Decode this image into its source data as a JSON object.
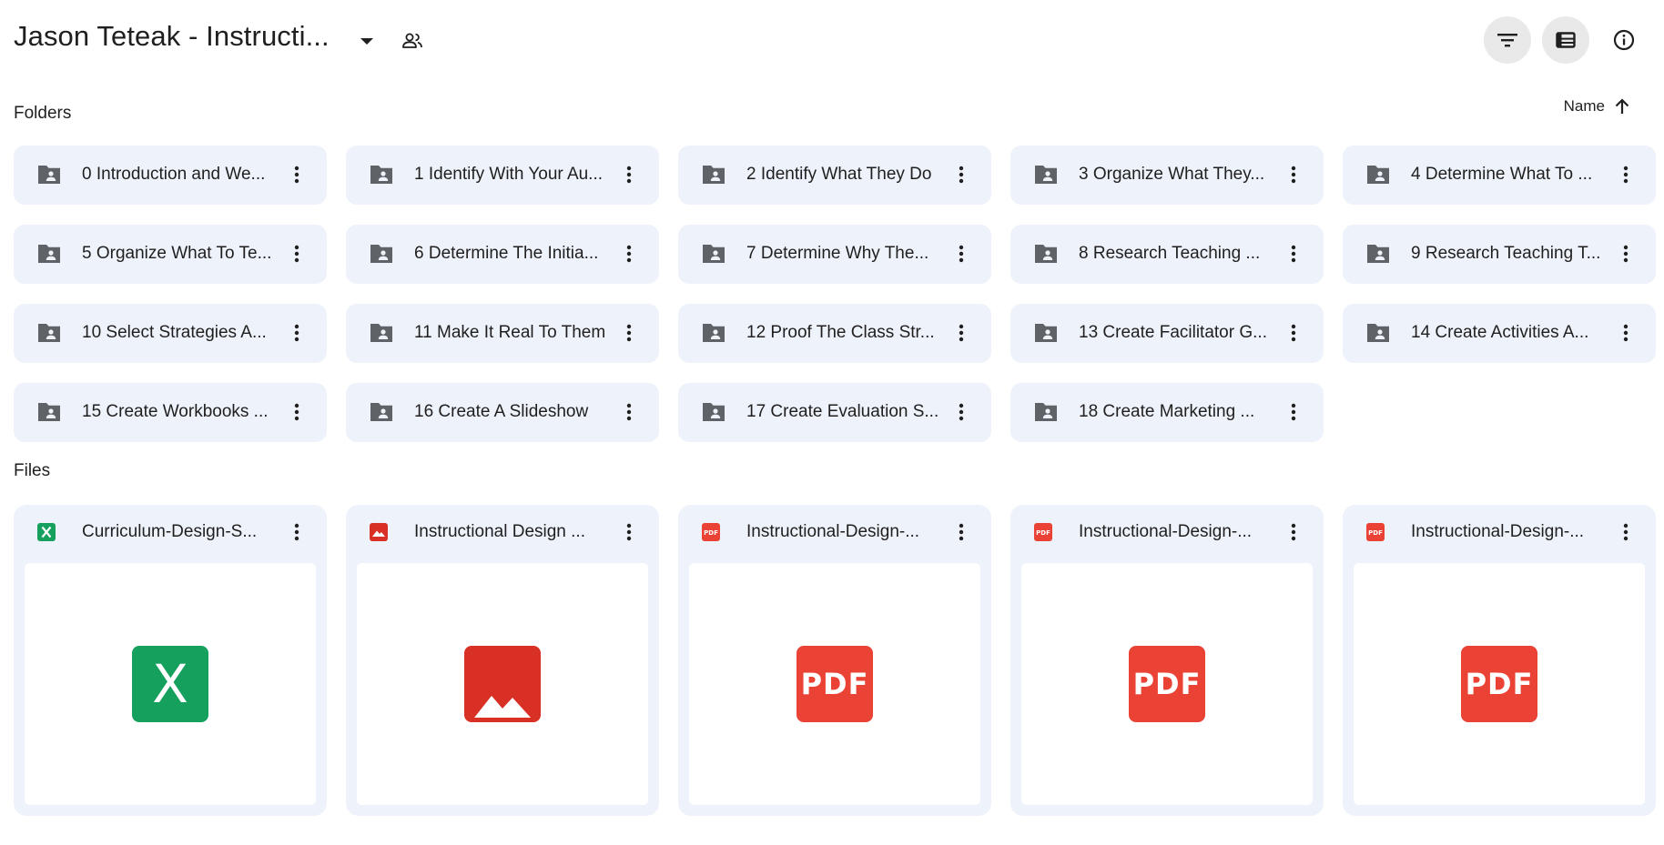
{
  "header": {
    "title": "Jason Teteak - Instructi..."
  },
  "sections": {
    "folders_label": "Folders",
    "files_label": "Files"
  },
  "sort": {
    "label": "Name",
    "direction": "ascending"
  },
  "folders": [
    {
      "name": "0 Introduction and We..."
    },
    {
      "name": "1 Identify With Your Au..."
    },
    {
      "name": "2 Identify What They Do"
    },
    {
      "name": "3 Organize What They..."
    },
    {
      "name": "4 Determine What To ..."
    },
    {
      "name": "5 Organize What To Te..."
    },
    {
      "name": "6 Determine The Initia..."
    },
    {
      "name": "7 Determine Why The..."
    },
    {
      "name": "8 Research Teaching ..."
    },
    {
      "name": "9 Research Teaching T..."
    },
    {
      "name": "10 Select Strategies A..."
    },
    {
      "name": "11 Make It Real To Them"
    },
    {
      "name": "12 Proof The Class Str..."
    },
    {
      "name": "13 Create Facilitator G..."
    },
    {
      "name": "14 Create Activities A..."
    },
    {
      "name": "15 Create Workbooks ..."
    },
    {
      "name": "16 Create A Slideshow"
    },
    {
      "name": "17 Create Evaluation S..."
    },
    {
      "name": "18 Create Marketing ..."
    }
  ],
  "files": [
    {
      "name": "Curriculum-Design-S...",
      "type": "spreadsheet",
      "icon": "excel-icon",
      "color": "#16a05d"
    },
    {
      "name": "Instructional Design ...",
      "type": "image",
      "icon": "image-icon",
      "color": "#d93025"
    },
    {
      "name": "Instructional-Design-...",
      "type": "pdf",
      "icon": "pdf-icon",
      "color": "#ea4335"
    },
    {
      "name": "Instructional-Design-...",
      "type": "pdf",
      "icon": "pdf-icon",
      "color": "#ea4335"
    },
    {
      "name": "Instructional-Design-...",
      "type": "pdf",
      "icon": "pdf-icon",
      "color": "#ea4335"
    }
  ],
  "preview_text": {
    "pdf": "PDF",
    "excel": "X"
  },
  "colors": {
    "card_bg": "#eef2fa",
    "folder_icon": "#5f6368",
    "icon_button_bg": "#e9e9ea"
  }
}
